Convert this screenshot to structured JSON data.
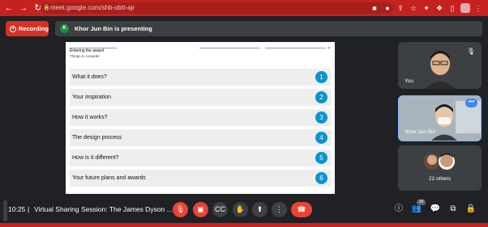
{
  "browser": {
    "url": "meet.google.com/shb-obtt-ajr",
    "back_icon": "back-arrow-icon",
    "forward_icon": "forward-arrow-icon",
    "reload_icon": "reload-icon",
    "accent": "#c5221f"
  },
  "banner": {
    "recording_label": "Recording",
    "presenter_initial": "K",
    "presenting_text": "Khor Jun Bin is presenting"
  },
  "slide": {
    "title": "Entering the award",
    "subtitle": "Things to consider",
    "items": [
      {
        "label": "What it does?",
        "number": "1"
      },
      {
        "label": "Your inspiration",
        "number": "2"
      },
      {
        "label": "How it works?",
        "number": "3"
      },
      {
        "label": "The design process",
        "number": "4"
      },
      {
        "label": "How is it different?",
        "number": "5"
      },
      {
        "label": "Your future plans and awards",
        "number": "6"
      }
    ],
    "accent": "#0b94d0"
  },
  "participants": {
    "you_label": "You",
    "presenter_label": "Khor Jun Bin",
    "others_label": "22 others"
  },
  "footer": {
    "time": "10:25",
    "separator": "|",
    "meeting_title": "Virtual Sharing Session: The James Dyson ...",
    "people_count": "28"
  }
}
